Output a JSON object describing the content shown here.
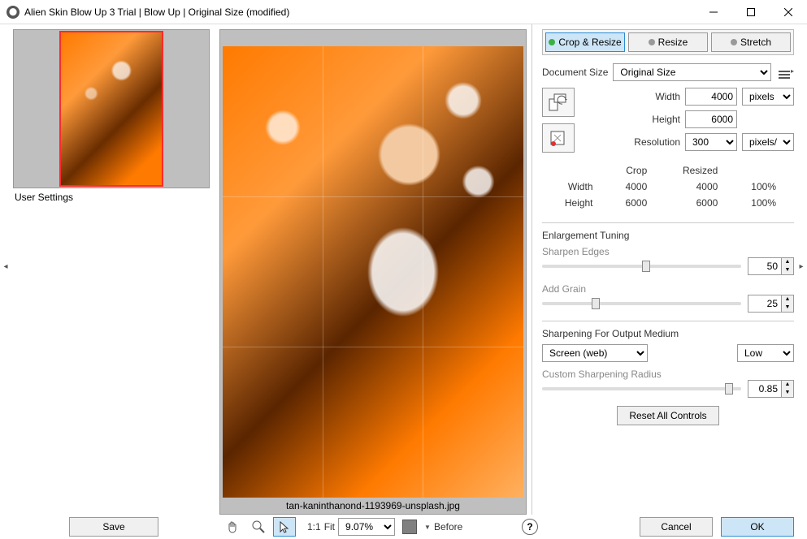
{
  "window": {
    "title": "Alien Skin Blow Up 3 Trial | Blow Up | Original Size (modified)"
  },
  "left": {
    "user_settings_label": "User Settings"
  },
  "preview": {
    "filename": "tan-kaninthanond-1193969-unsplash.jpg"
  },
  "tabs": {
    "crop_resize": "Crop & Resize",
    "resize": "Resize",
    "stretch": "Stretch"
  },
  "docsize": {
    "label": "Document Size",
    "value": "Original Size"
  },
  "size": {
    "width_label": "Width",
    "width_value": "4000",
    "height_label": "Height",
    "height_value": "6000",
    "unit": "pixels",
    "resolution_label": "Resolution",
    "resolution_value": "300",
    "resolution_unit": "pixels/in"
  },
  "crop_table": {
    "col_crop": "Crop",
    "col_resized": "Resized",
    "row_width": "Width",
    "row_height": "Height",
    "width_crop": "4000",
    "width_resized": "4000",
    "width_pct": "100%",
    "height_crop": "6000",
    "height_resized": "6000",
    "height_pct": "100%"
  },
  "enl": {
    "title": "Enlargement Tuning",
    "sharpen_label": "Sharpen Edges",
    "sharpen_value": "50",
    "grain_label": "Add Grain",
    "grain_value": "25"
  },
  "sharp_out": {
    "title": "Sharpening For Output Medium",
    "medium": "Screen (web)",
    "level": "Low",
    "radius_label": "Custom Sharpening Radius",
    "radius_value": "0.85"
  },
  "buttons": {
    "reset": "Reset All Controls",
    "save": "Save",
    "cancel": "Cancel",
    "ok": "OK",
    "one_to_one": "1:1",
    "fit": "Fit",
    "before": "Before"
  },
  "zoom": {
    "value": "9.07%"
  }
}
